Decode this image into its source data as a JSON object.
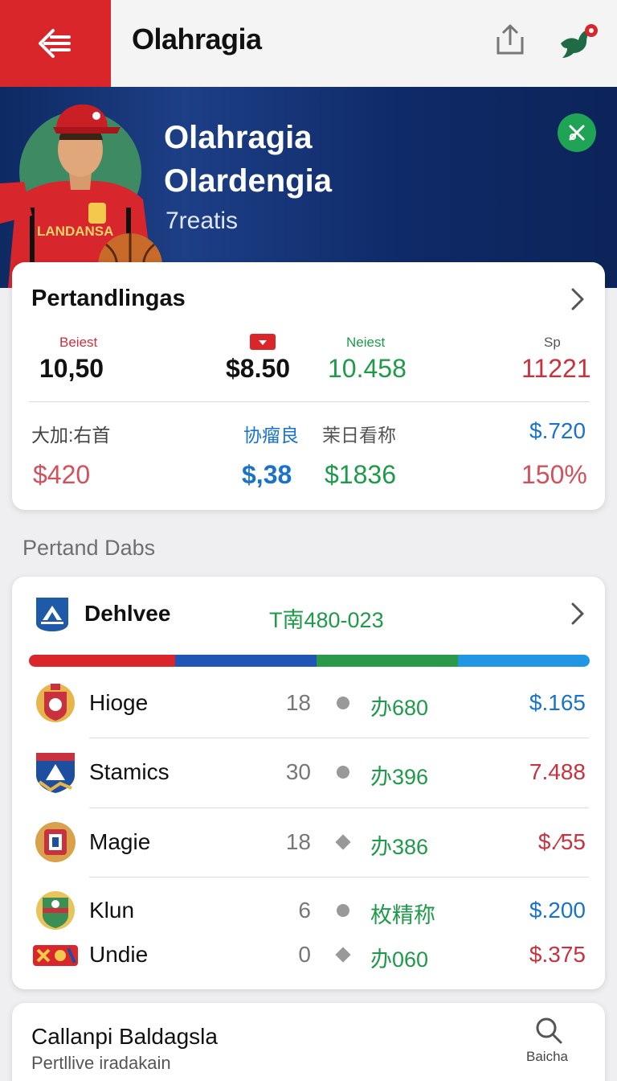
{
  "header": {
    "title": "Olahragia",
    "back_icon": "back-arrow-icon",
    "share_icon": "share-icon",
    "bird_icon": "bird-notification-icon",
    "accent": "#d9262b"
  },
  "hero": {
    "title_line1": "Olahragia",
    "title_line2": "Olardengia",
    "subtitle": "7reatis",
    "jersey_text": "LANDANSA",
    "action_icon": "close-icon",
    "action_color": "#1fa456"
  },
  "stats_card": {
    "title": "Pertandlingas",
    "row1": {
      "labels": [
        "Beiest",
        "",
        "Neiest",
        "Sp"
      ],
      "values": [
        "10,50",
        "$8.50",
        "10.458",
        "11221"
      ]
    },
    "row2": {
      "labels": [
        "大加:右首",
        "协瘤良",
        "茉日看称",
        "$.720"
      ],
      "values": [
        "$420",
        "$,38",
        "$1836",
        "150%"
      ]
    }
  },
  "section_label": "Pertand Dabs",
  "league_card": {
    "name": "Dehlvee",
    "code": "T南480-023",
    "bar_colors": [
      "#d9262b",
      "#1f56b5",
      "#2a9a4a",
      "#2196e3"
    ],
    "teams": [
      {
        "name": "Hioge",
        "num": "18",
        "stat": "办680",
        "price": "$.165",
        "price_color": "#1a73c8",
        "marker": "circle"
      },
      {
        "name": "Stamics",
        "num": "30",
        "stat": "办396",
        "price": "7.488",
        "price_color": "#c8323f",
        "marker": "circle"
      },
      {
        "name": "Magie",
        "num": "18",
        "stat": "办386",
        "price": "$.⁄55",
        "price_color": "#c8323f",
        "marker": "diamond"
      },
      {
        "name": "Klun",
        "num": "6",
        "stat": "枚精称",
        "price": "$.200",
        "price_color": "#1a73c8",
        "marker": "circle"
      },
      {
        "name": "Undie",
        "num": "0",
        "stat": "办060",
        "price": "$.375",
        "price_color": "#c8323f",
        "marker": "diamond"
      }
    ]
  },
  "bottom_card": {
    "title": "Callanpi Baldagsla",
    "subtitle": "Pertllive iradakain",
    "search_label": "Baicha",
    "search_icon": "search-icon"
  }
}
